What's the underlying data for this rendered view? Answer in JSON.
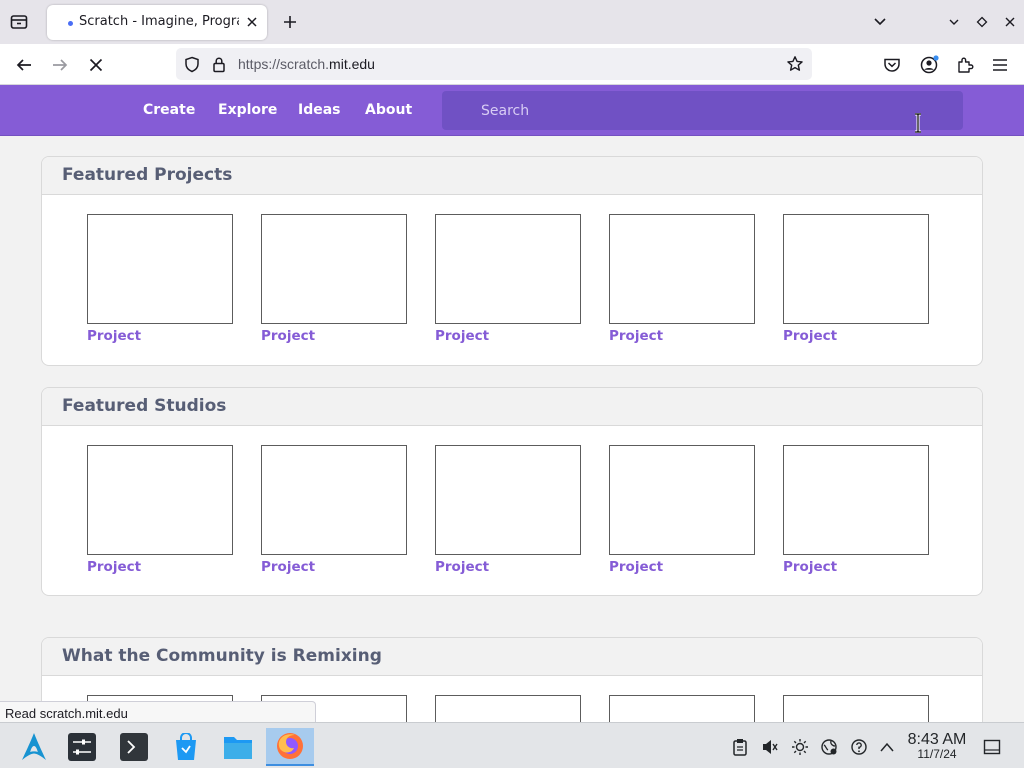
{
  "browser": {
    "tab_title": "Scratch - Imagine, Program, Create",
    "url_prefix": "https://scratch.",
    "url_host": "mit.edu",
    "status_text": "Read scratch.mit.edu"
  },
  "scratch_nav": {
    "items": [
      {
        "label": "Create"
      },
      {
        "label": "Explore"
      },
      {
        "label": "Ideas"
      },
      {
        "label": "About"
      }
    ],
    "search_placeholder": "Search"
  },
  "sections": [
    {
      "title": "Featured Projects",
      "tiles": [
        "Project",
        "Project",
        "Project",
        "Project",
        "Project"
      ]
    },
    {
      "title": "Featured Studios",
      "tiles": [
        "Project",
        "Project",
        "Project",
        "Project",
        "Project"
      ]
    },
    {
      "title": "What the Community is Remixing",
      "tiles": [
        "",
        "",
        "",
        "",
        ""
      ]
    }
  ],
  "taskbar": {
    "time": "8:43 AM",
    "date": "11/7/24"
  },
  "colors": {
    "brand": "#855cd6",
    "search_bg": "#7051c4",
    "title_text": "#575e75"
  }
}
